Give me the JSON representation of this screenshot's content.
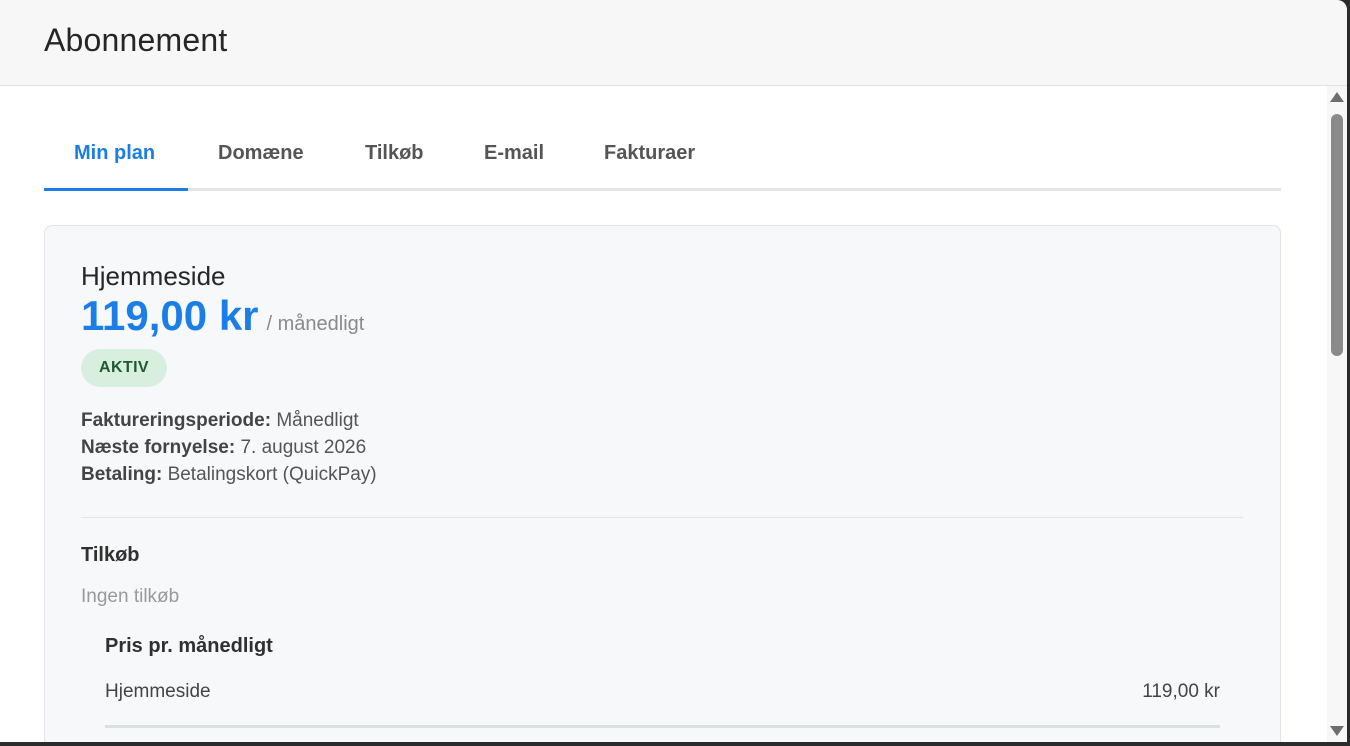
{
  "header": {
    "title": "Abonnement"
  },
  "tabs": [
    {
      "label": "Min plan",
      "active": true
    },
    {
      "label": "Domæne",
      "active": false
    },
    {
      "label": "Tilkøb",
      "active": false
    },
    {
      "label": "E-mail",
      "active": false
    },
    {
      "label": "Fakturaer",
      "active": false
    }
  ],
  "plan": {
    "name": "Hjemmeside",
    "price": "119,00 kr",
    "period": "/ månedligt",
    "status": "AKTIV",
    "details": {
      "billing_period_label": "Faktureringsperiode:",
      "billing_period_value": "Månedligt",
      "next_renewal_label": "Næste fornyelse:",
      "next_renewal_value": "7. august 2026",
      "payment_label": "Betaling:",
      "payment_value": "Betalingskort (QuickPay)"
    }
  },
  "addons": {
    "title": "Tilkøb",
    "empty_text": "Ingen tilkøb"
  },
  "pricing": {
    "title": "Pris pr. månedligt",
    "lines": [
      {
        "label": "Hjemmeside",
        "amount": "119,00 kr"
      }
    ]
  },
  "colors": {
    "accent": "#1a7ee6",
    "badge_bg": "#d8efdf",
    "badge_text": "#1f5a2e"
  }
}
